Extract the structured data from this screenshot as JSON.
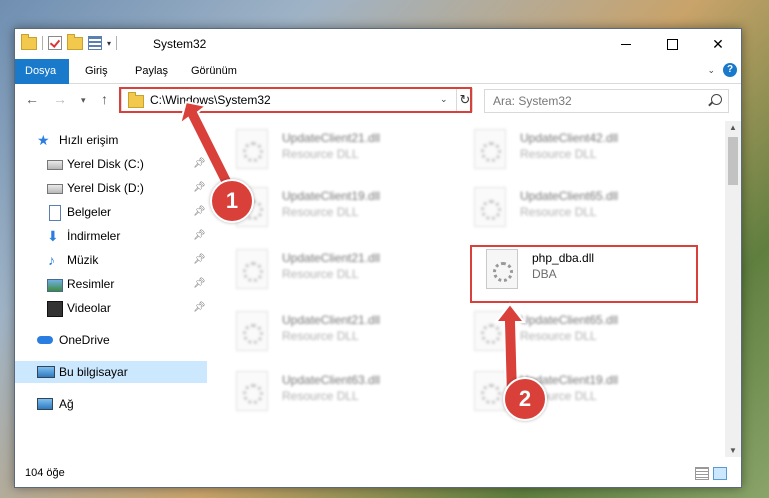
{
  "window": {
    "title": "System32"
  },
  "ribbon": {
    "tabs": [
      "Dosya",
      "Giriş",
      "Paylaş",
      "Görünüm"
    ],
    "help": "?"
  },
  "navigation": {
    "address": "C:\\Windows\\System32",
    "search_placeholder": "Ara: System32"
  },
  "sidebar": {
    "quick_access": "Hızlı erişim",
    "items": [
      {
        "label": "Yerel Disk (C:)",
        "icon": "drive-icon",
        "pinned": true
      },
      {
        "label": "Yerel Disk (D:)",
        "icon": "drive-icon",
        "pinned": true
      },
      {
        "label": "Belgeler",
        "icon": "documents-icon",
        "pinned": true
      },
      {
        "label": "İndirmeler",
        "icon": "downloads-icon",
        "pinned": true
      },
      {
        "label": "Müzik",
        "icon": "music-icon",
        "pinned": true
      },
      {
        "label": "Resimler",
        "icon": "pictures-icon",
        "pinned": true
      },
      {
        "label": "Videolar",
        "icon": "videos-icon",
        "pinned": true
      }
    ],
    "onedrive": "OneDrive",
    "this_pc": "Bu bilgisayar",
    "network": "Ağ"
  },
  "files": [
    {
      "name": "UpdateClient21.dll",
      "desc": "Resource DLL",
      "blurred": true
    },
    {
      "name": "UpdateClient42.dll",
      "desc": "Resource DLL",
      "blurred": true
    },
    {
      "name": "UpdateClient19.dll",
      "desc": "Resource DLL",
      "blurred": true
    },
    {
      "name": "UpdateClient65.dll",
      "desc": "Resource DLL",
      "blurred": true
    },
    {
      "name": "UpdateClient21.dll",
      "desc": "Resource DLL",
      "blurred": true
    },
    {
      "name": "php_dba.dll",
      "desc": "DBA",
      "blurred": false
    },
    {
      "name": "UpdateClient21.dll",
      "desc": "Resource DLL",
      "blurred": true
    },
    {
      "name": "UpdateClient65.dll",
      "desc": "Resource DLL",
      "blurred": true
    },
    {
      "name": "UpdateClient63.dll",
      "desc": "Resource DLL",
      "blurred": true
    },
    {
      "name": "UpdateClient19.dll",
      "desc": "Resource DLL",
      "blurred": true
    }
  ],
  "status": {
    "item_count": "104 öğe"
  },
  "annotations": {
    "step1": "1",
    "step2": "2"
  },
  "colors": {
    "accent": "#1979ca",
    "highlight": "#d9403a",
    "selected": "#cce8ff"
  }
}
